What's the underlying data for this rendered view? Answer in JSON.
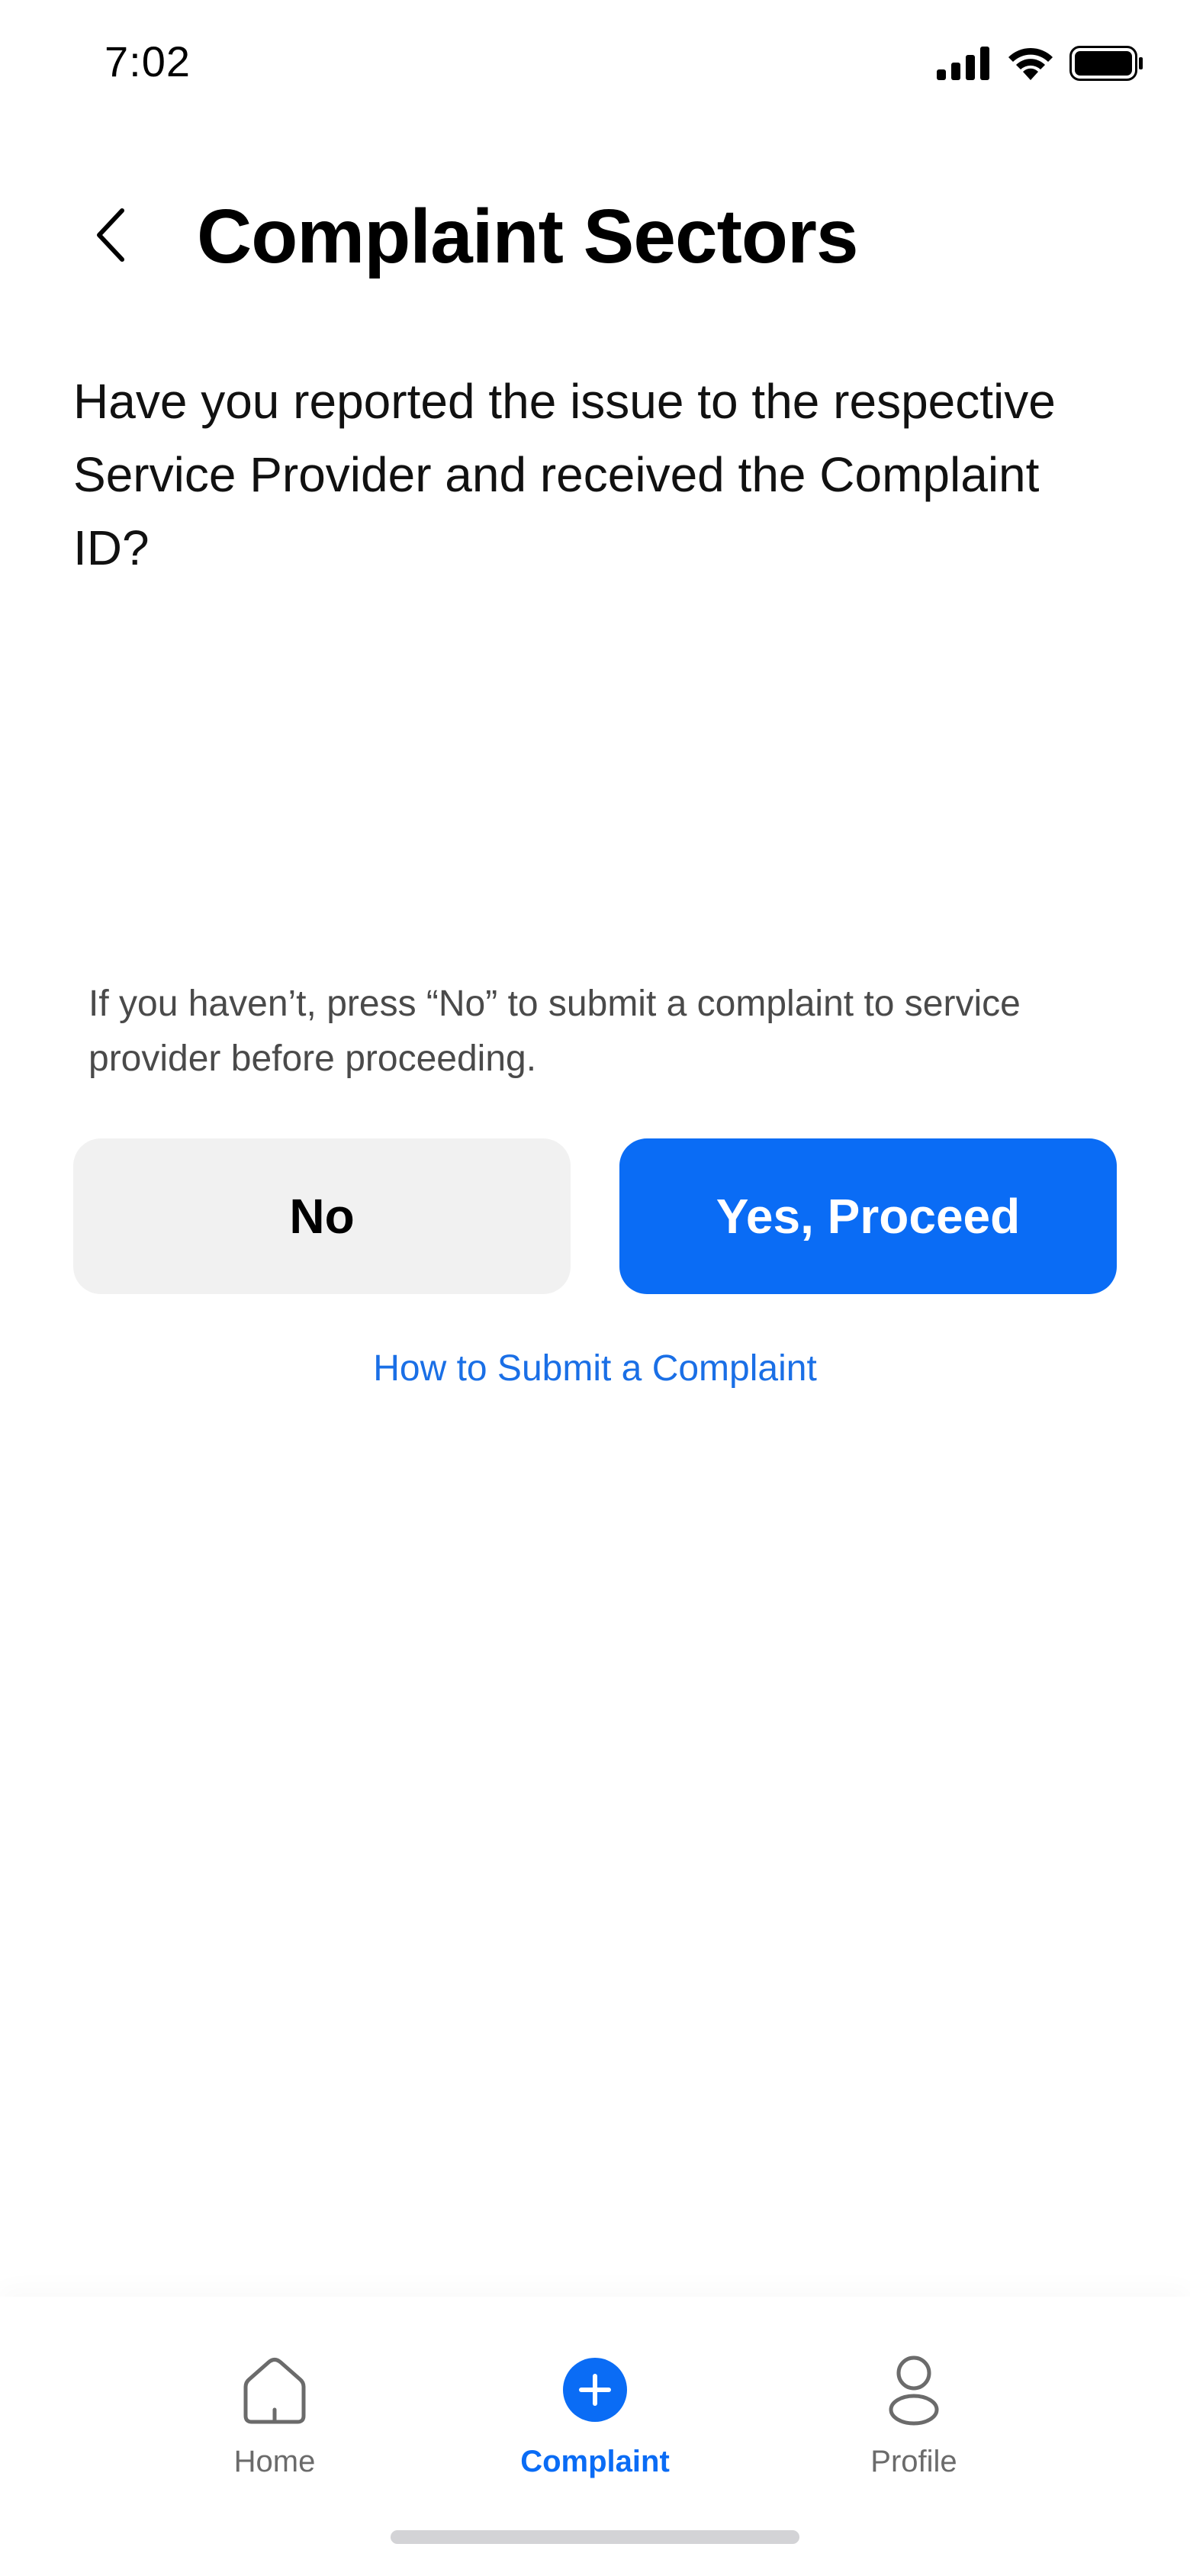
{
  "status_bar": {
    "time": "7:02",
    "icons": [
      "signal-icon",
      "wifi-icon",
      "battery-icon"
    ]
  },
  "header": {
    "back_icon": "chevron-left-icon",
    "title": "Complaint Sectors"
  },
  "question": "Have you reported the issue to the respective Service Provider and received the Complaint ID?",
  "hint": "If you haven’t, press “No” to submit a complaint to service provider before proceeding.",
  "buttons": {
    "no_label": "No",
    "yes_label": "Yes, Proceed"
  },
  "help_link": "How to Submit a Complaint",
  "tabbar": {
    "tabs": [
      {
        "label": "Home",
        "icon": "home-icon",
        "active": false
      },
      {
        "label": "Complaint",
        "icon": "plus-circle-icon",
        "active": true
      },
      {
        "label": "Profile",
        "icon": "user-icon",
        "active": false
      }
    ]
  },
  "colors": {
    "primary": "#0a6cf5",
    "secondary_button_bg": "#f1f1f1",
    "link": "#1a6fe6",
    "muted_text": "#4a4a4a",
    "inactive_tab": "#6b6b6b"
  }
}
